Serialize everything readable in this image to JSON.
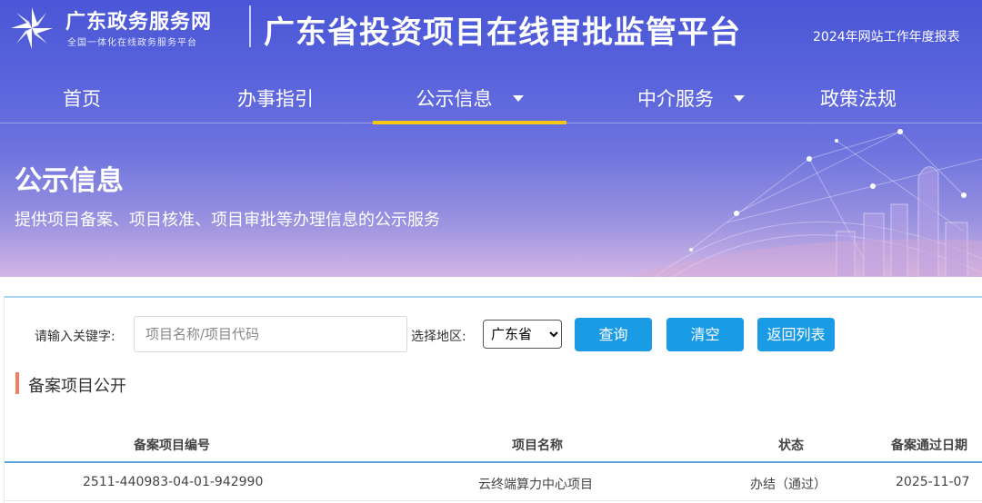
{
  "header": {
    "logo_title": "广东政务服务网",
    "logo_subtitle": "全国一体化在线政务服务平台",
    "platform_title": "广东省投资项目在线审批监管平台",
    "report_link": "2024年网站工作年度报表"
  },
  "nav": {
    "items": [
      {
        "label": "首页",
        "active": false,
        "has_dropdown": false
      },
      {
        "label": "办事指引",
        "active": false,
        "has_dropdown": false
      },
      {
        "label": "公示信息",
        "active": true,
        "has_dropdown": true
      },
      {
        "label": "中介服务",
        "active": false,
        "has_dropdown": true
      },
      {
        "label": "政策法规",
        "active": false,
        "has_dropdown": false
      }
    ],
    "active_indicator_color": "#f5c518"
  },
  "hero": {
    "title": "公示信息",
    "subtitle": "提供项目备案、项目核准、项目审批等办理信息的公示服务"
  },
  "search": {
    "keyword_label": "请输入关键字:",
    "keyword_value": "",
    "keyword_placeholder": "项目名称/项目代码",
    "region_label": "选择地区:",
    "region_selected": "广东省",
    "query_button": "查询",
    "clear_button": "清空",
    "back_button": "返回列表",
    "button_color": "#1a9be6"
  },
  "section": {
    "title": "备案项目公开",
    "accent_color": "#f08060"
  },
  "table": {
    "headers": [
      "备案项目编号",
      "项目名称",
      "状态",
      "备案通过日期"
    ],
    "rows": [
      [
        "2511-440983-04-01-942990",
        "云终端算力中心项目",
        "办结（通过）",
        "2025-11-07"
      ]
    ]
  }
}
